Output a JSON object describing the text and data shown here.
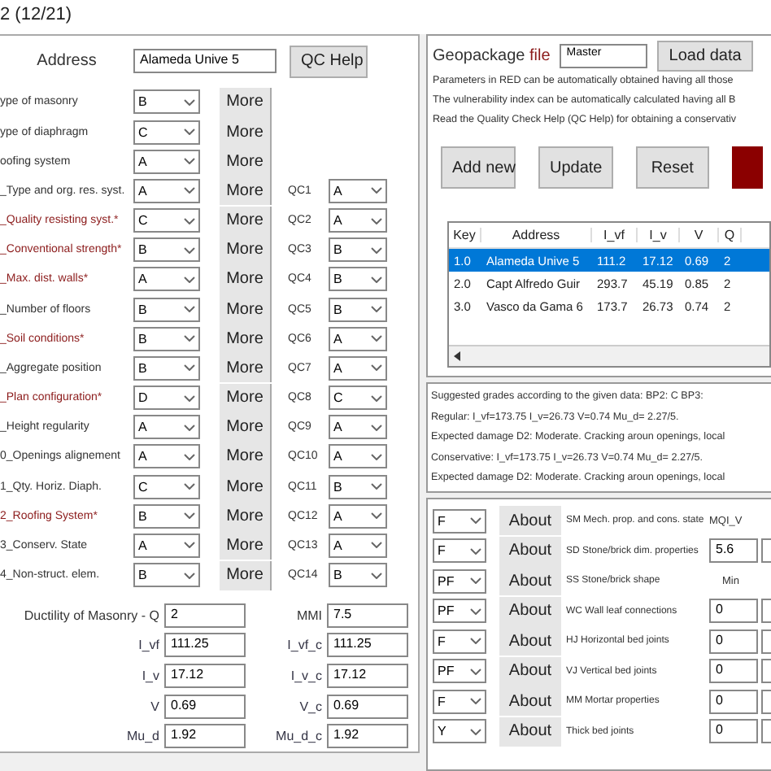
{
  "window": {
    "title": "2 (12/21)"
  },
  "address": {
    "label": "Address",
    "value": "Alameda Unive 5",
    "help_button": "QC Help"
  },
  "parameters": [
    {
      "label": "ype of masonry",
      "red": false,
      "value": "B",
      "more": "More"
    },
    {
      "label": "ype of diaphragm",
      "red": false,
      "value": "C",
      "more": "More"
    },
    {
      "label": "oofing system",
      "red": false,
      "value": "A",
      "more": "More"
    },
    {
      "label": "_Type and org. res. syst.",
      "red": false,
      "value": "A",
      "more": "More",
      "qc_label": "QC1",
      "qc_value": "A"
    },
    {
      "label": "_Quality resisting syst.*",
      "red": true,
      "value": "C",
      "more": "More",
      "qc_label": "QC2",
      "qc_value": "A"
    },
    {
      "label": "_Conventional strength*",
      "red": true,
      "value": "B",
      "more": "More",
      "qc_label": "QC3",
      "qc_value": "B"
    },
    {
      "label": "_Max. dist. walls*",
      "red": true,
      "value": "A",
      "more": "More",
      "qc_label": "QC4",
      "qc_value": "B"
    },
    {
      "label": "_Number of floors",
      "red": false,
      "value": "B",
      "more": "More",
      "qc_label": "QC5",
      "qc_value": "B"
    },
    {
      "label": "_Soil conditions*",
      "red": true,
      "value": "B",
      "more": "More",
      "qc_label": "QC6",
      "qc_value": "A"
    },
    {
      "label": "_Aggregate position",
      "red": false,
      "value": "B",
      "more": "More",
      "qc_label": "QC7",
      "qc_value": "A"
    },
    {
      "label": "_Plan configuration*",
      "red": true,
      "value": "D",
      "more": "More",
      "qc_label": "QC8",
      "qc_value": "C"
    },
    {
      "label": "_Height regularity",
      "red": false,
      "value": "A",
      "more": "More",
      "qc_label": "QC9",
      "qc_value": "A"
    },
    {
      "label": "0_Openings alignement",
      "red": false,
      "value": "A",
      "more": "More",
      "qc_label": "QC10",
      "qc_value": "A"
    },
    {
      "label": "1_Qty. Horiz. Diaph.",
      "red": false,
      "value": "C",
      "more": "More",
      "qc_label": "QC11",
      "qc_value": "B"
    },
    {
      "label": "2_Roofing System*",
      "red": true,
      "value": "B",
      "more": "More",
      "qc_label": "QC12",
      "qc_value": "A"
    },
    {
      "label": "3_Conserv. State",
      "red": false,
      "value": "A",
      "more": "More",
      "qc_label": "QC13",
      "qc_value": "A"
    },
    {
      "label": "4_Non-struct. elem.",
      "red": false,
      "value": "B",
      "more": "More",
      "qc_label": "QC14",
      "qc_value": "B"
    }
  ],
  "results": [
    {
      "label": "Ductility of Masonry - Q",
      "value": "2",
      "label_2": "MMI",
      "value_2": "7.5"
    },
    {
      "label": "I_vf",
      "value": "111.25",
      "label_2": "I_vf_c",
      "value_2": "111.25"
    },
    {
      "label": "I_v",
      "value": "17.12",
      "label_2": "I_v_c",
      "value_2": "17.12"
    },
    {
      "label": "V",
      "value": "0.69",
      "label_2": "V_c",
      "value_2": "0.69"
    },
    {
      "label": "Mu_d",
      "value": "1.92",
      "label_2": "Mu_d_c",
      "value_2": "1.92"
    }
  ],
  "geopackage": {
    "label": "Geopackage",
    "label_red": "file",
    "value": "Master",
    "load_button": "Load data"
  },
  "notes": [
    "Parameters in RED can be automatically obtained having all those",
    "The vulnerability index can be automatically calculated having all B",
    "Read the Quality Check Help (QC Help) for obtaining a conservativ"
  ],
  "buttons": [
    "Add new",
    "Update",
    "Reset"
  ],
  "table": {
    "columns": [
      "Key",
      "Address",
      "I_vf",
      "I_v",
      "V",
      "Q"
    ],
    "rows": [
      {
        "cells": [
          "1.0",
          "Alameda Unive 5",
          "111.2",
          "17.12",
          "0.69",
          "2"
        ],
        "selected": true
      },
      {
        "cells": [
          "2.0",
          "Capt Alfredo Guir",
          "293.7",
          "45.19",
          "0.85",
          "2"
        ],
        "selected": false
      },
      {
        "cells": [
          "3.0",
          "Vasco da Gama 6",
          "173.7",
          "26.73",
          "0.74",
          "2"
        ],
        "selected": false
      }
    ]
  },
  "summary": [
    "Suggested grades according to the given data: BP2:  C    BP3:",
    "Regular:       I_vf=173.75   I_v=26.73   V=0.74  Mu_d=  2.27/5.",
    "Expected damage D2: Moderate. Cracking aroun openings, local",
    "Conservative: I_vf=173.75   I_v=26.73   V=0.74  Mu_d=  2.27/5.",
    "Expected damage D2: Moderate. Cracking aroun openings, local"
  ],
  "mqi": {
    "header": "MQI_V",
    "min_label": "Min",
    "rows": [
      {
        "value": "F",
        "about": "About",
        "label": "SM Mech. prop. and cons. state",
        "field": null
      },
      {
        "value": "F",
        "about": "About",
        "label": "SD Stone/brick dim. properties",
        "field": "5.6"
      },
      {
        "value": "PF",
        "about": "About",
        "label": "SS Stone/brick shape",
        "field": null
      },
      {
        "value": "PF",
        "about": "About",
        "label": "WC Wall leaf connections",
        "field": "0"
      },
      {
        "value": "F",
        "about": "About",
        "label": "HJ Horizontal bed joints",
        "field": "0"
      },
      {
        "value": "PF",
        "about": "About",
        "label": "VJ Vertical bed joints",
        "field": "0"
      },
      {
        "value": "F",
        "about": "About",
        "label": "MM Mortar properties",
        "field": "0"
      },
      {
        "value": "Y",
        "about": "About",
        "label": "Thick bed joints",
        "field": "0"
      }
    ]
  }
}
